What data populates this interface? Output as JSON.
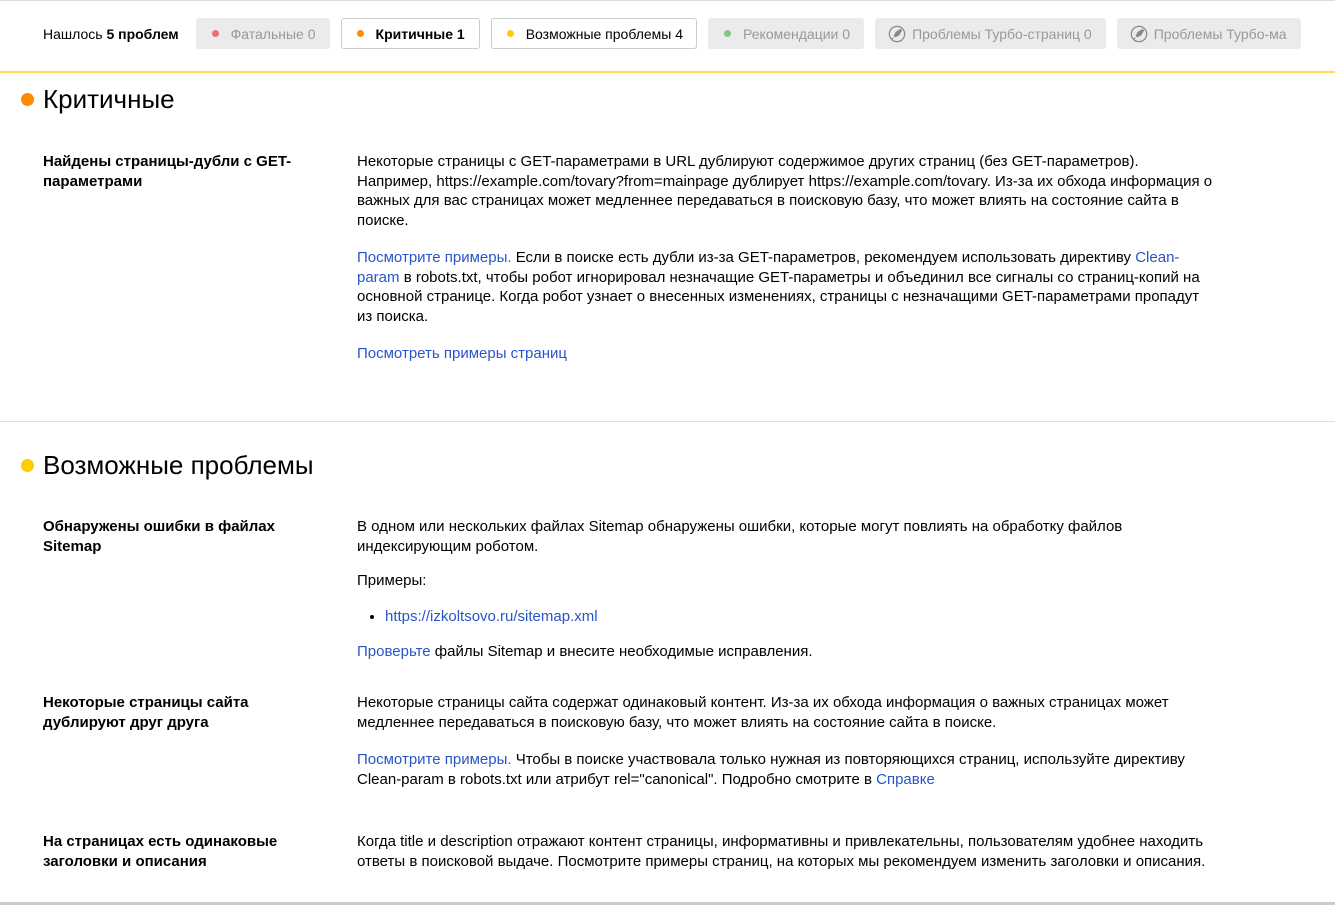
{
  "filters": {
    "found_prefix": "Нашлось",
    "found_count": "5 проблем",
    "chips": [
      {
        "label": "Фатальные 0",
        "color": "#e57373",
        "state": "disabled"
      },
      {
        "label": "Критичные 1",
        "color": "#ff8c00",
        "state": "active"
      },
      {
        "label": "Возможные проблемы 4",
        "color": "#ffcc00",
        "state": "active"
      },
      {
        "label": "Рекомендации 0",
        "color": "#81c784",
        "state": "disabled"
      },
      {
        "label": "Проблемы Турбо-страниц 0",
        "icon": "rocket-icon",
        "state": "disabled"
      },
      {
        "label": "Проблемы Турбо-ма",
        "icon": "rocket-icon",
        "state": "disabled"
      }
    ]
  },
  "critical": {
    "title": "Критичные",
    "color": "#ff8c00",
    "items": [
      {
        "title": "Найдены страницы-дубли с GET-параметрами",
        "p1": "Некоторые страницы с GET-параметрами в URL дублируют содержимое других страниц (без GET-параметров). Например, https://example.com/tovary?from=mainpage дублирует https://example.com/tovary. Из-за их обхода информация о важных для вас страницах может медленнее передаваться в поисковую базу, что может влиять на состояние сайта в поиске.",
        "p2_link": "Посмотрите примеры.",
        "p2_a": " Если в поиске есть дубли из-за GET-параметров, рекомендуем использовать директиву ",
        "p2_link2": "Clean-param",
        "p2_b": " в robots.txt, чтобы робот игнорировал незначащие GET-параметры и объединил все сигналы со страниц-копий на основной странице. Когда робот узнает о внесенных изменениях, страницы с незначащими GET-параметрами пропадут из поиска.",
        "link": "Посмотреть примеры страниц"
      }
    ]
  },
  "possible": {
    "title": "Возможные проблемы",
    "color": "#ffcc00",
    "items": [
      {
        "title": "Обнаружены ошибки в файлах Sitemap",
        "p1": "В одном или нескольких файлах Sitemap обнаружены ошибки, которые могут повлиять на обработку файлов индексирующим роботом.",
        "examples_label": "Примеры:",
        "example": "https://izkoltsovo.ru/sitemap.xml",
        "p3_link": "Проверьте",
        "p3": " файлы Sitemap и внесите необходимые исправления."
      },
      {
        "title": "Некоторые страницы сайта дублируют друг друга",
        "p1": "Некоторые страницы сайта содержат одинаковый контент. Из-за их обхода информация о важных страницах может медленнее передаваться в поисковую базу, что может влиять на состояние сайта в поиске.",
        "p2_link": "Посмотрите примеры.",
        "p2": " Чтобы в поиске участвовала только нужная из повторяющихся страниц, используйте директиву Clean-param в robots.txt или атрибут rel=\"canonical\". Подробно смотрите в ",
        "p2_link2": "Справке"
      },
      {
        "title": "На страницах есть одинаковые заголовки и описания",
        "p1": "Когда title и description отражают контент страницы, информативны и привлекательны, пользователям удобнее находить ответы в поисковой выдаче. Посмотрите примеры страниц, на которых мы рекомендуем изменить заголовки и описания."
      }
    ]
  }
}
